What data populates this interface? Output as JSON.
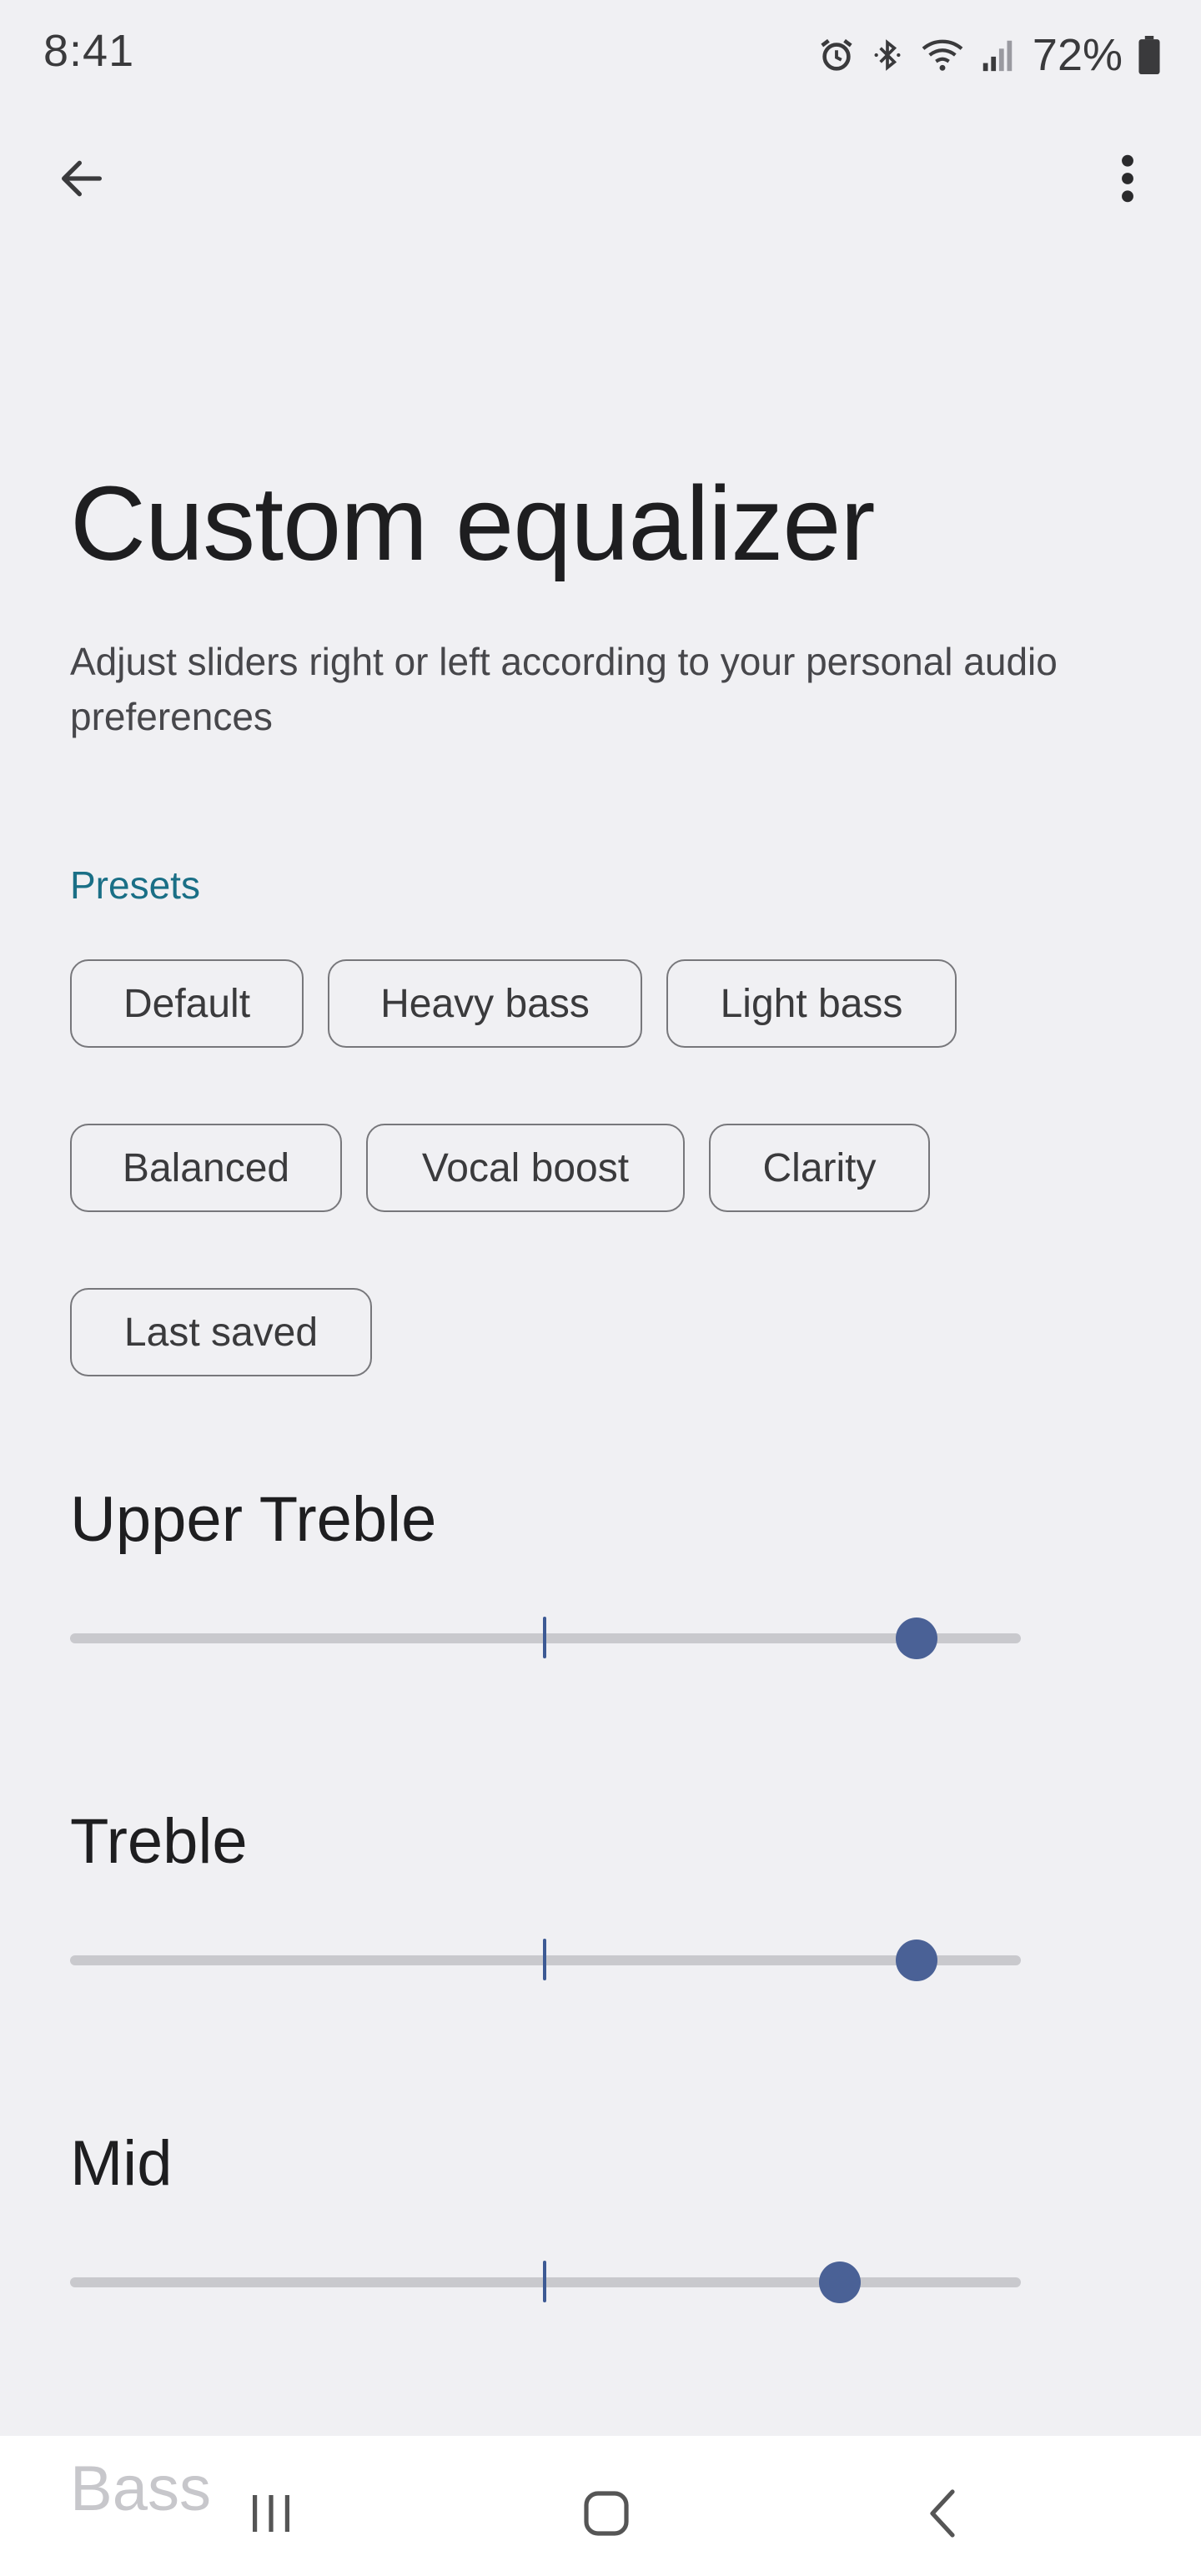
{
  "status_bar": {
    "time": "8:41",
    "battery": "72%",
    "icons": [
      "alarm-icon",
      "bluetooth-icon",
      "wifi-icon",
      "signal-icon",
      "battery-icon"
    ]
  },
  "app_bar": {
    "back_icon": "arrow-back-icon",
    "menu_icon": "more-vert-icon"
  },
  "page": {
    "title": "Custom equalizer",
    "subtitle": "Adjust sliders right or left according to your personal audio preferences"
  },
  "presets": {
    "label": "Presets",
    "items": [
      "Default",
      "Heavy bass",
      "Light bass",
      "Balanced",
      "Vocal boost",
      "Clarity",
      "Last saved"
    ]
  },
  "bands": [
    {
      "label": "Upper Treble",
      "value": 0.89
    },
    {
      "label": "Treble",
      "value": 0.89
    },
    {
      "label": "Mid",
      "value": 0.81
    },
    {
      "label": "Bass"
    }
  ],
  "colors": {
    "background": "#f0f0f3",
    "accent": "#4a6196",
    "section_label": "#1a6f86",
    "track": "#c9c9cd"
  },
  "nav_bar": {
    "icons": [
      "recent-apps-icon",
      "home-icon",
      "back-nav-icon"
    ]
  }
}
